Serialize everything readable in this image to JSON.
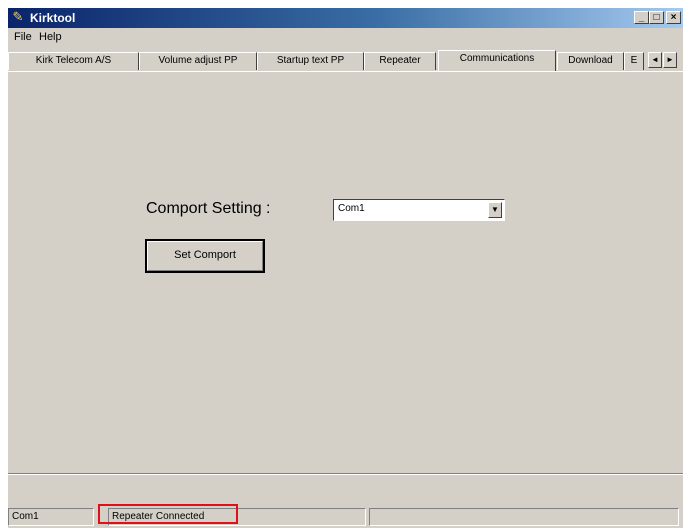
{
  "window": {
    "title": "Kirktool",
    "icon": "wrench-icon",
    "controls": {
      "minimize": "_",
      "maximize": "□",
      "close": "×"
    }
  },
  "menubar": {
    "items": [
      "File",
      "Help"
    ]
  },
  "tabs": {
    "items": [
      "Kirk Telecom A/S",
      "Volume adjust PP",
      "Startup text PP",
      "Repeater",
      "Communications",
      "Download",
      "E"
    ],
    "active": "Communications",
    "scroll_left": "◄",
    "scroll_right": "►"
  },
  "content": {
    "comport_label": "Comport Setting :",
    "comport_value": "Com1",
    "dropdown_arrow": "▼",
    "set_button": "Set Comport"
  },
  "statusbar": {
    "port": "Com1",
    "status": "Repeater Connected",
    "extra": ""
  },
  "colors": {
    "face": "#d4d0c8",
    "title_start": "#0a246a",
    "title_end": "#a6caf0",
    "highlight": "#e0101a"
  }
}
